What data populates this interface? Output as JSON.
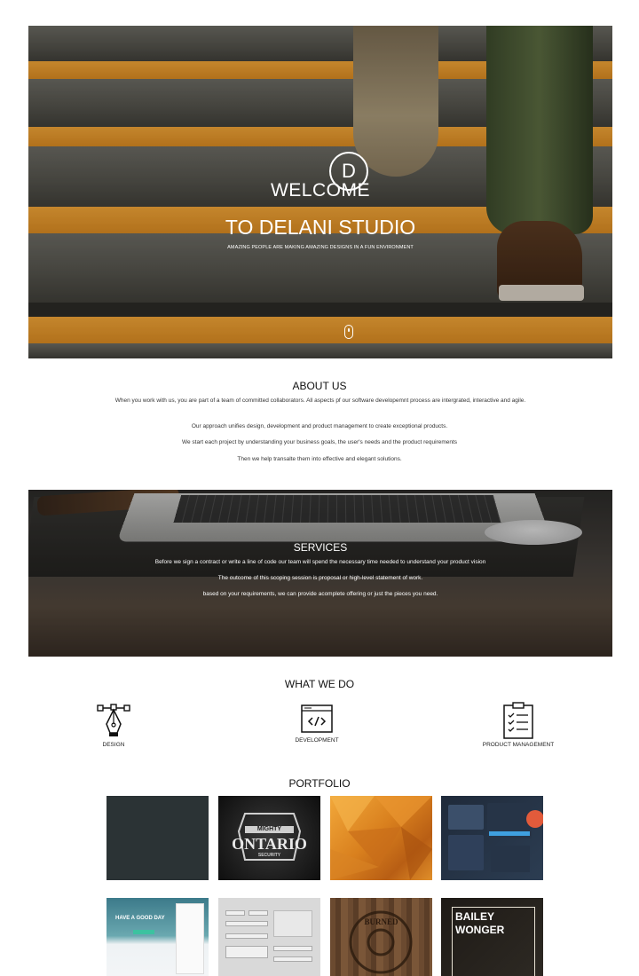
{
  "hero": {
    "logo_letter": "D",
    "welcome": "WELCOME",
    "title": "TO DELANI STUDIO",
    "tagline": "AMAZING PEOPLE ARE MAKING AMAZING DESIGNS IN A FUN ENVIRONMENT"
  },
  "about": {
    "title": "ABOUT US",
    "paragraphs": [
      "When you work with us, you are part of a team of committed collaborators. All aspects pf our software developemnt process are intergrated, interactive and agile.",
      "Our approach unifies design, development and product management to create exceptional products.",
      "We start each project by understanding your business goals, the user's needs and the product requirements",
      "Then we help transalte them into effective and elegant solutions."
    ]
  },
  "services": {
    "title": "SERVICES",
    "paragraphs": [
      "Before we sign a contract or write a line of code our team will spend the necessary time needed to understand your product vision",
      "The outcome of this scoping session is proposal or high-level statement of work.",
      "based on your requirements, we can provide acomplete offering or just the pieces you need."
    ]
  },
  "what_we_do": {
    "title": "WHAT WE DO",
    "items": [
      {
        "label": "DESIGN",
        "icon": "pen-tool-icon"
      },
      {
        "label": "DEVELOPMENT",
        "icon": "code-window-icon"
      },
      {
        "label": "PRODUCT MANAGEMENT",
        "icon": "clipboard-checklist-icon"
      }
    ]
  },
  "portfolio": {
    "title": "PORTFOLIO",
    "tiles": [
      {
        "name": "dark-slate"
      },
      {
        "name": "mighty-ontario-logo",
        "line1": "MIGHTY",
        "line2": "ONTARIO",
        "line3": "SECURITY"
      },
      {
        "name": "orange-polygon"
      },
      {
        "name": "dark-dashboard-ui"
      },
      {
        "name": "website-mockup",
        "headline": "HAVE A GOOD DAY"
      },
      {
        "name": "ui-kit-gray"
      },
      {
        "name": "burned-logo-wood",
        "text": "BURNED"
      },
      {
        "name": "bailey-wonger",
        "line1": "BAILEY",
        "line2": "WONGER"
      }
    ]
  }
}
